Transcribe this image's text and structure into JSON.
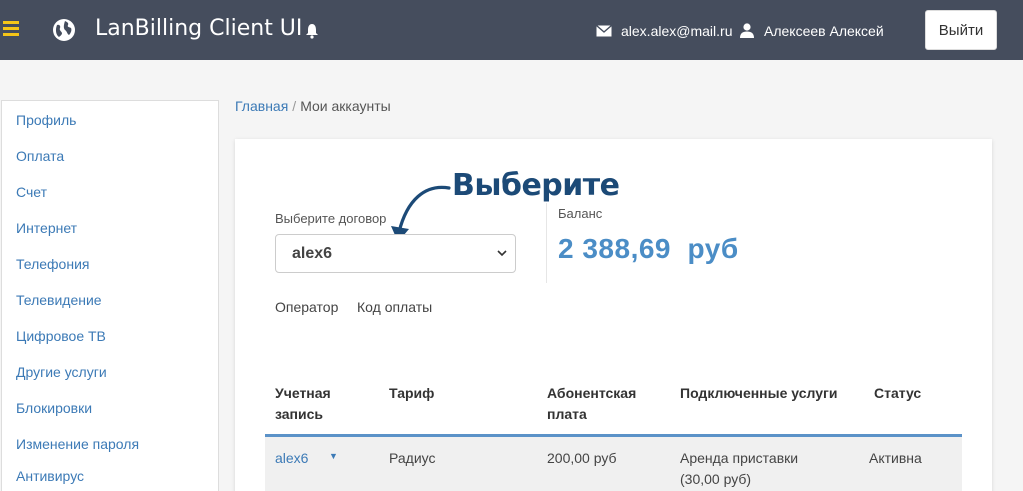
{
  "header": {
    "brand": "LanBilling Client UI",
    "email": "alex.alex@mail.ru",
    "username": "Алексеев Алексей",
    "logout_label": "Выйти",
    "colors": {
      "bar": "#454d5d",
      "menu_icon": "#f5c518"
    }
  },
  "sidebar": {
    "items": [
      {
        "label": "Профиль"
      },
      {
        "label": "Оплата"
      },
      {
        "label": "Счет"
      },
      {
        "label": "Интернет"
      },
      {
        "label": "Телефония"
      },
      {
        "label": "Телевидение"
      },
      {
        "label": "Цифровое ТВ"
      },
      {
        "label": "Другие услуги"
      },
      {
        "label": "Блокировки"
      },
      {
        "label": "Изменение пароля"
      },
      {
        "label": "Антивирус"
      }
    ]
  },
  "breadcrumb": {
    "home": "Главная",
    "current": "Мои аккаунты"
  },
  "annotation": {
    "hint": "Выберите"
  },
  "contract": {
    "label": "Выберите договор",
    "selected": "alex6"
  },
  "balance": {
    "label": "Баланс",
    "value": "2 388,69  руб"
  },
  "links": {
    "operator": "Оператор",
    "paycode": "Код оплаты"
  },
  "table": {
    "headers": {
      "account_line1": "Учетная",
      "account_line2": "запись",
      "tariff": "Тариф",
      "fee_line1": "Абонентская",
      "fee_line2": "плата",
      "services": "Подключенные услуги",
      "status": "Статус"
    },
    "rows": [
      {
        "account": "alex6",
        "tariff": "Радиус",
        "fee": "200,00 руб",
        "services_line1": "Аренда приставки",
        "services_line2": "(30,00 руб)",
        "status": "Активна"
      }
    ]
  }
}
